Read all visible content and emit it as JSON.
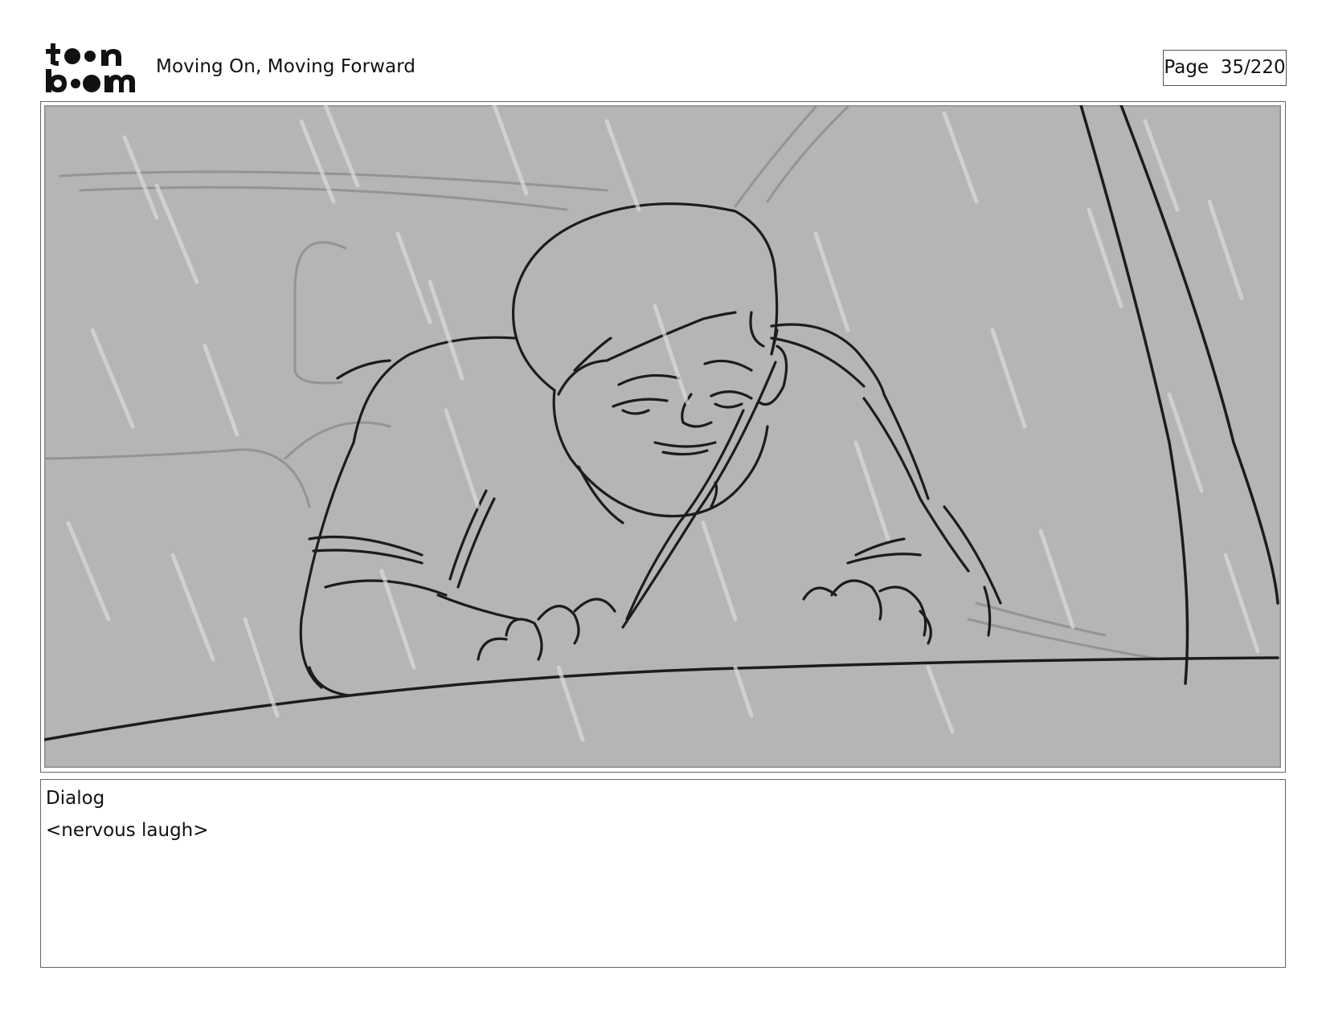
{
  "header": {
    "logo_text": "toon boom",
    "title": "Moving On, Moving Forward",
    "page_label": "Page  35/220"
  },
  "panel": {
    "background_color": "#b5b5b5",
    "line_color": "#1c1c1c",
    "rain_color": "#dcdcdc"
  },
  "dialog": {
    "label": "Dialog",
    "text": "<nervous laugh>"
  }
}
